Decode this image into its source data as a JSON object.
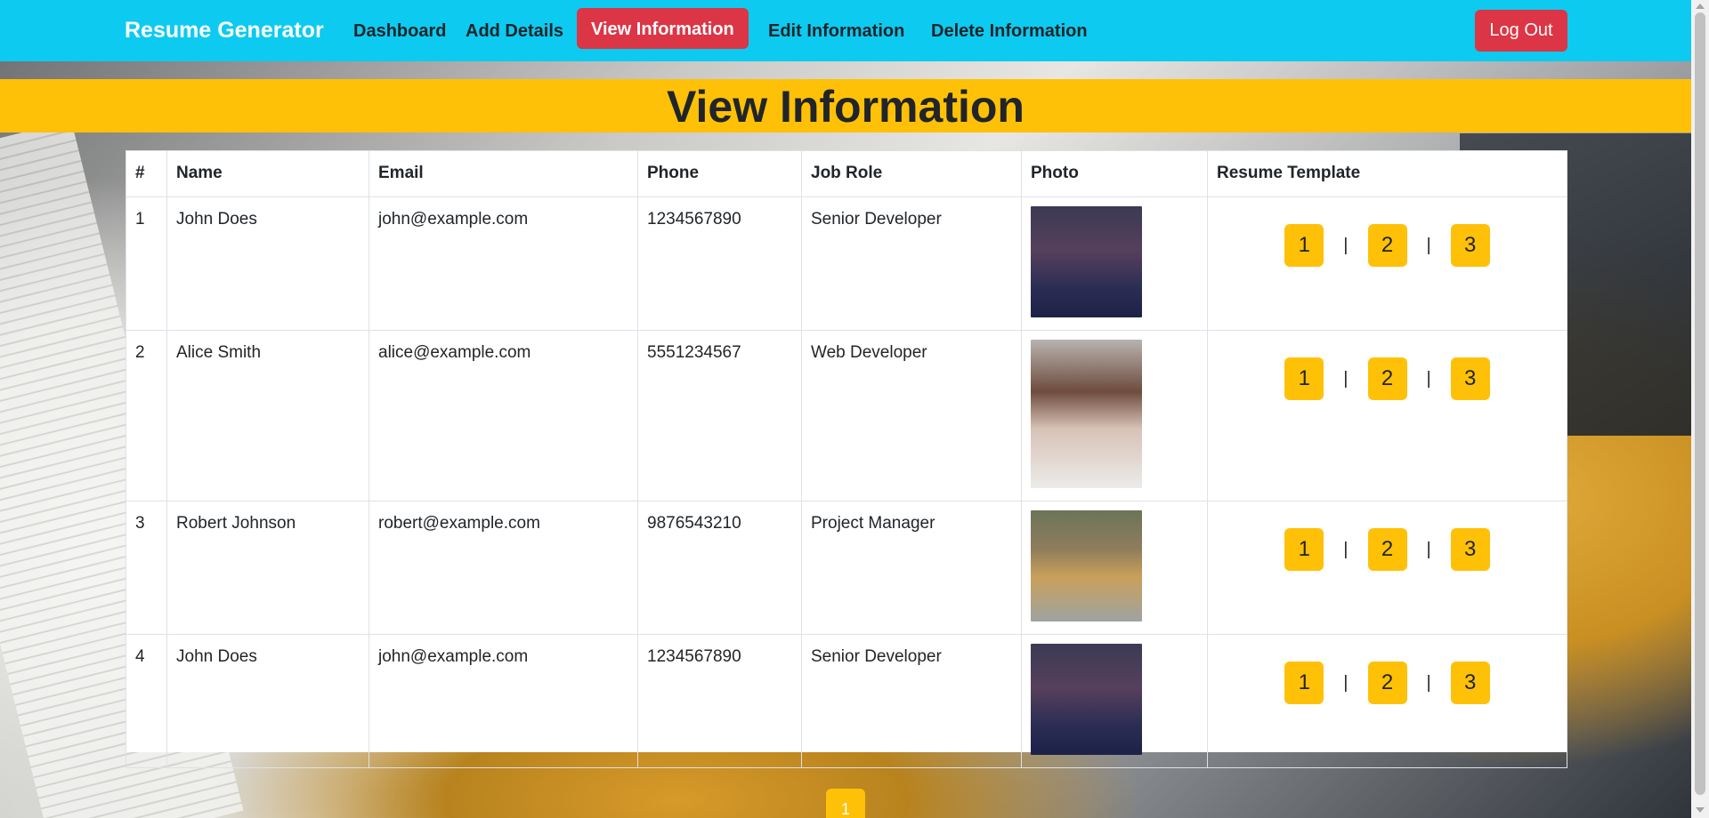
{
  "nav": {
    "brand": "Resume Generator",
    "links": [
      "Dashboard",
      "Add Details",
      "View Information",
      "Edit Information",
      "Delete Information"
    ],
    "active": "View Information",
    "logout": "Log Out"
  },
  "page": {
    "title": "View Information"
  },
  "table": {
    "headers": [
      "#",
      "Name",
      "Email",
      "Phone",
      "Job Role",
      "Photo",
      "Resume Template"
    ],
    "rows": [
      {
        "num": "1",
        "name": "John Does",
        "email": "john@example.com",
        "phone": "1234567890",
        "role": "Senior Developer",
        "photo": "man-portrait"
      },
      {
        "num": "2",
        "name": "Alice Smith",
        "email": "alice@example.com",
        "phone": "5551234567",
        "role": "Web Developer",
        "photo": "woman-portrait"
      },
      {
        "num": "3",
        "name": "Robert Johnson",
        "email": "robert@example.com",
        "phone": "9876543210",
        "role": "Project Manager",
        "photo": "teen-portrait"
      },
      {
        "num": "4",
        "name": "John Does",
        "email": "john@example.com",
        "phone": "1234567890",
        "role": "Senior Developer",
        "photo": "man-portrait"
      }
    ],
    "template_buttons": [
      "1",
      "2",
      "3"
    ],
    "separator": "|"
  },
  "pagination": {
    "current": "1"
  },
  "colors": {
    "navbar": "#0dcaf0",
    "accent": "#ffc107",
    "danger": "#dc3545"
  }
}
